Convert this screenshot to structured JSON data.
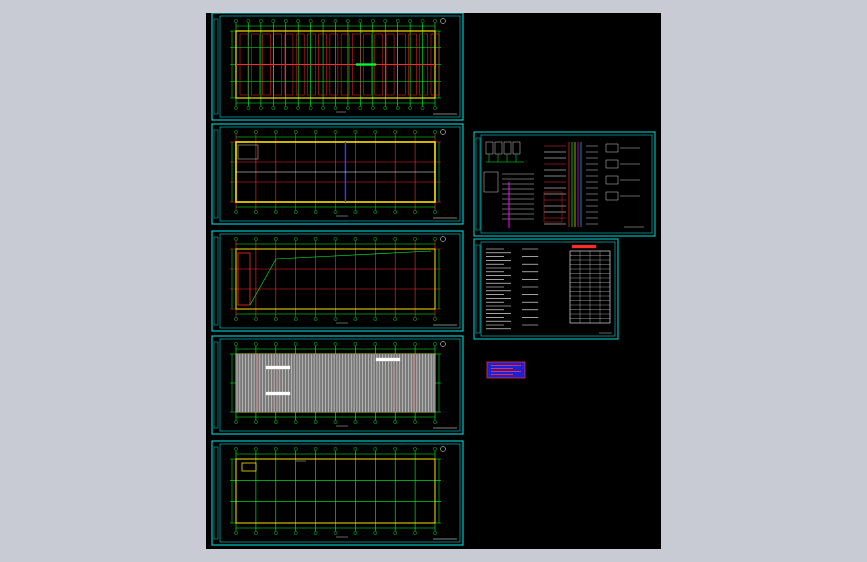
{
  "viewer": {
    "background_color": "#c8cbd3",
    "canvas_color": "#000000"
  },
  "drawing": {
    "colors": {
      "frame": "#00d7d7",
      "grid": "#00ff2a",
      "column_line": "#ff2a2a",
      "wall": "#ffe000",
      "white": "#ffffff",
      "stamp_fill": "#1a22d8",
      "stamp_text": "#ff2a2a"
    },
    "sheets": [
      {
        "id": "plan-1",
        "type": "floor-plan-red"
      },
      {
        "id": "plan-2",
        "type": "floor-plan-grid"
      },
      {
        "id": "plan-3",
        "type": "floor-plan-diagonal"
      },
      {
        "id": "plan-4",
        "type": "roof-hatched"
      },
      {
        "id": "plan-5",
        "type": "foundation-grid"
      },
      {
        "id": "system-diagram",
        "type": "wiring-diagram"
      },
      {
        "id": "notes-table",
        "type": "notes-and-table"
      }
    ],
    "stamp": {
      "type": "title-stamp"
    }
  }
}
